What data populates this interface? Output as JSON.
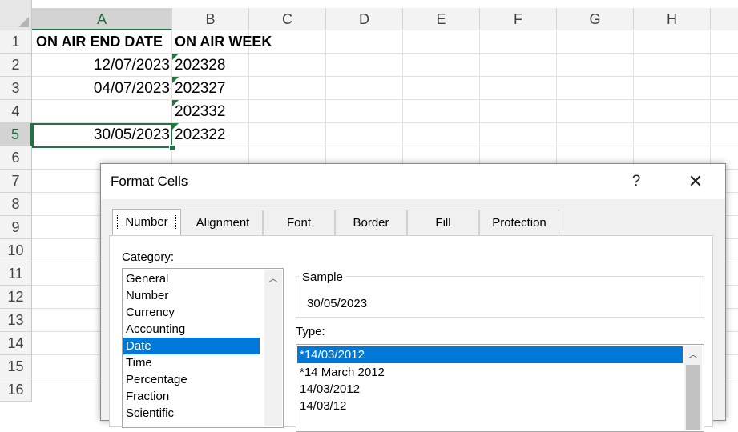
{
  "columns": [
    "A",
    "B",
    "C",
    "D",
    "E",
    "F",
    "G",
    "H"
  ],
  "rows": [
    "1",
    "2",
    "3",
    "4",
    "5",
    "6",
    "7",
    "8",
    "9",
    "10",
    "11",
    "12",
    "13",
    "14",
    "15",
    "16"
  ],
  "cells": {
    "a1": "ON AIR END DATE",
    "b1": "ON AIR WEEK",
    "a2": "12/07/2023",
    "b2": "202328",
    "a3": "04/07/2023",
    "b3": "202327",
    "a4": "",
    "b4": "202332",
    "a5": "30/05/2023",
    "b5": "202322"
  },
  "dialog": {
    "title": "Format Cells",
    "help": "?",
    "close": "✕",
    "tabs": [
      "Number",
      "Alignment",
      "Font",
      "Border",
      "Fill",
      "Protection"
    ],
    "active_tab": "Number",
    "category_label": "Category:",
    "categories": [
      "General",
      "Number",
      "Currency",
      "Accounting",
      "Date",
      "Time",
      "Percentage",
      "Fraction",
      "Scientific"
    ],
    "selected_category": "Date",
    "sample_label": "Sample",
    "sample_value": "30/05/2023",
    "type_label": "Type:",
    "types": [
      "*14/03/2012",
      "*14 March 2012",
      "14/03/2012",
      "14/03/12"
    ],
    "selected_type": "*14/03/2012"
  },
  "colors": {
    "accent": "#217346",
    "selection": "#0078d7",
    "error_indicator": "#1e7a3a"
  }
}
